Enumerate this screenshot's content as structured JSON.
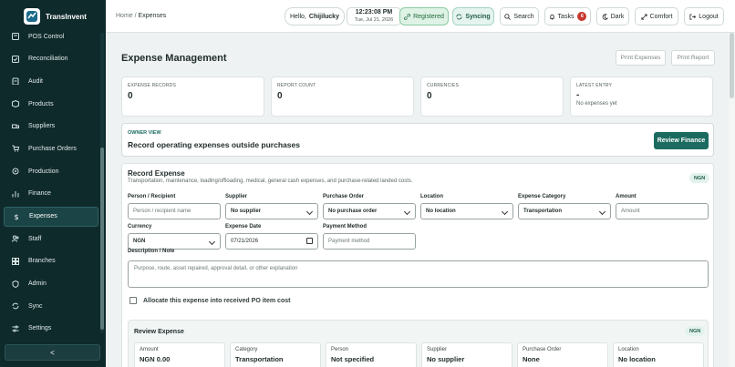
{
  "brand": {
    "name": "TransInvent"
  },
  "sidebar": {
    "items": [
      {
        "label": "POS Control",
        "icon": "pos-icon"
      },
      {
        "label": "Reconciliation",
        "icon": "check-square-icon"
      },
      {
        "label": "Audit",
        "icon": "clipboard-icon"
      },
      {
        "label": "Products",
        "icon": "box-icon"
      },
      {
        "label": "Suppliers",
        "icon": "truck-icon"
      },
      {
        "label": "Purchase Orders",
        "icon": "cart-icon"
      },
      {
        "label": "Production",
        "icon": "gear-icon"
      },
      {
        "label": "Finance",
        "icon": "chart-icon"
      },
      {
        "label": "Expenses",
        "icon": "dollar-icon",
        "active": true
      },
      {
        "label": "Staff",
        "icon": "users-icon"
      },
      {
        "label": "Branches",
        "icon": "grid-icon"
      },
      {
        "label": "Admin",
        "icon": "shield-icon"
      },
      {
        "label": "Sync",
        "icon": "sync-icon"
      },
      {
        "label": "Settings",
        "icon": "sliders-icon"
      }
    ],
    "collapse_label": "<"
  },
  "topbar": {
    "breadcrumb_home": "Home",
    "breadcrumb_sep": "/",
    "breadcrumb_current": "Expenses",
    "hello": "Hello,",
    "user": "Chijilucky",
    "time": "12:23:08 PM",
    "date": "Tue, Jul 21, 2026",
    "registered": "Registered",
    "syncing": "Syncing",
    "search": "Search",
    "tasks": "Tasks",
    "tasks_count": "6",
    "dark": "Dark",
    "comfort": "Comfort",
    "logout": "Logout"
  },
  "page": {
    "title": "Expense Management",
    "print_expenses": "Print Expenses",
    "print_report": "Print Report"
  },
  "stats": [
    {
      "label": "EXPENSE RECORDS",
      "value": "0",
      "sub": ""
    },
    {
      "label": "REPORT COUNT",
      "value": "0",
      "sub": ""
    },
    {
      "label": "CURRENCIES",
      "value": "0",
      "sub": ""
    },
    {
      "label": "LATEST ENTRY",
      "value": "-",
      "sub": "No expenses yet"
    }
  ],
  "owner": {
    "kicker": "OWNER VIEW",
    "heading": "Record operating expenses outside purchases",
    "button": "Review Finance"
  },
  "form": {
    "title": "Record Expense",
    "description": "Transportation, maintenance, loading/offloading, medical, general cash expenses, and purchase-related landed costs.",
    "currency_tag": "NGN",
    "person_label": "Person / Recipient",
    "person_placeholder": "Person / recipient name",
    "supplier_label": "Supplier",
    "supplier_value": "No supplier",
    "po_label": "Purchase Order",
    "po_value": "No purchase order",
    "location_label": "Location",
    "location_value": "No location",
    "category_label": "Expense Category",
    "category_value": "Transportation",
    "amount_label": "Amount",
    "amount_placeholder": "Amount",
    "currency_label": "Currency",
    "currency_value": "NGN",
    "date_label": "Expense Date",
    "date_value": "07/21/2026",
    "method_label": "Payment Method",
    "method_placeholder": "Payment method",
    "desc_label": "Description / Note",
    "desc_placeholder": "Purpose, route, asset repaired, approval detail, or other explanation",
    "allocate_label": "Allocate this expense into received PO item cost"
  },
  "review": {
    "title": "Review Expense",
    "currency_tag": "NGN",
    "cells": [
      {
        "key": "Amount",
        "value": "NGN 0.00"
      },
      {
        "key": "Category",
        "value": "Transportation"
      },
      {
        "key": "Person",
        "value": "Not specified"
      },
      {
        "key": "Supplier",
        "value": "No supplier"
      },
      {
        "key": "Purchase Order",
        "value": "None"
      },
      {
        "key": "Location",
        "value": "No location"
      }
    ]
  }
}
